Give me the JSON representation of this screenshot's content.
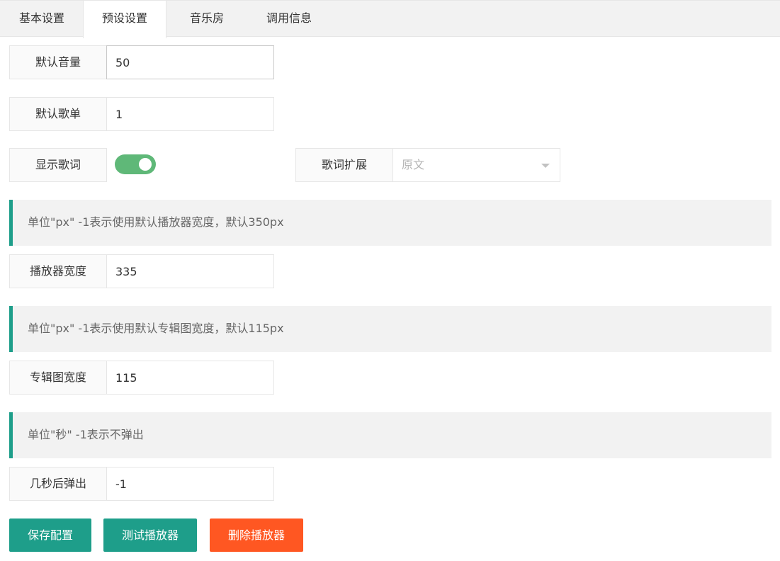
{
  "tabs": [
    {
      "label": "基本设置"
    },
    {
      "label": "预设设置"
    },
    {
      "label": "音乐房"
    },
    {
      "label": "调用信息"
    }
  ],
  "fields": {
    "volume": {
      "label": "默认音量",
      "value": "50"
    },
    "playlist": {
      "label": "默认歌单",
      "value": "1"
    },
    "show_lyrics": {
      "label": "显示歌词",
      "enabled": true
    },
    "lyrics_ext": {
      "label": "歌词扩展",
      "selected": "原文"
    },
    "player_width": {
      "tip": "单位\"px\" -1表示使用默认播放器宽度，默认350px",
      "label": "播放器宽度",
      "value": "335"
    },
    "cover_width": {
      "tip": "单位\"px\" -1表示使用默认专辑图宽度，默认115px",
      "label": "专辑图宽度",
      "value": "115"
    },
    "popup_delay": {
      "tip": "单位\"秒\" -1表示不弹出",
      "label": "几秒后弹出",
      "value": "-1"
    }
  },
  "buttons": {
    "save": "保存配置",
    "test": "测试播放器",
    "delete": "删除播放器"
  },
  "colors": {
    "primary": "#1e9e8a",
    "danger": "#ff5722",
    "switch_on": "#5fb878"
  }
}
